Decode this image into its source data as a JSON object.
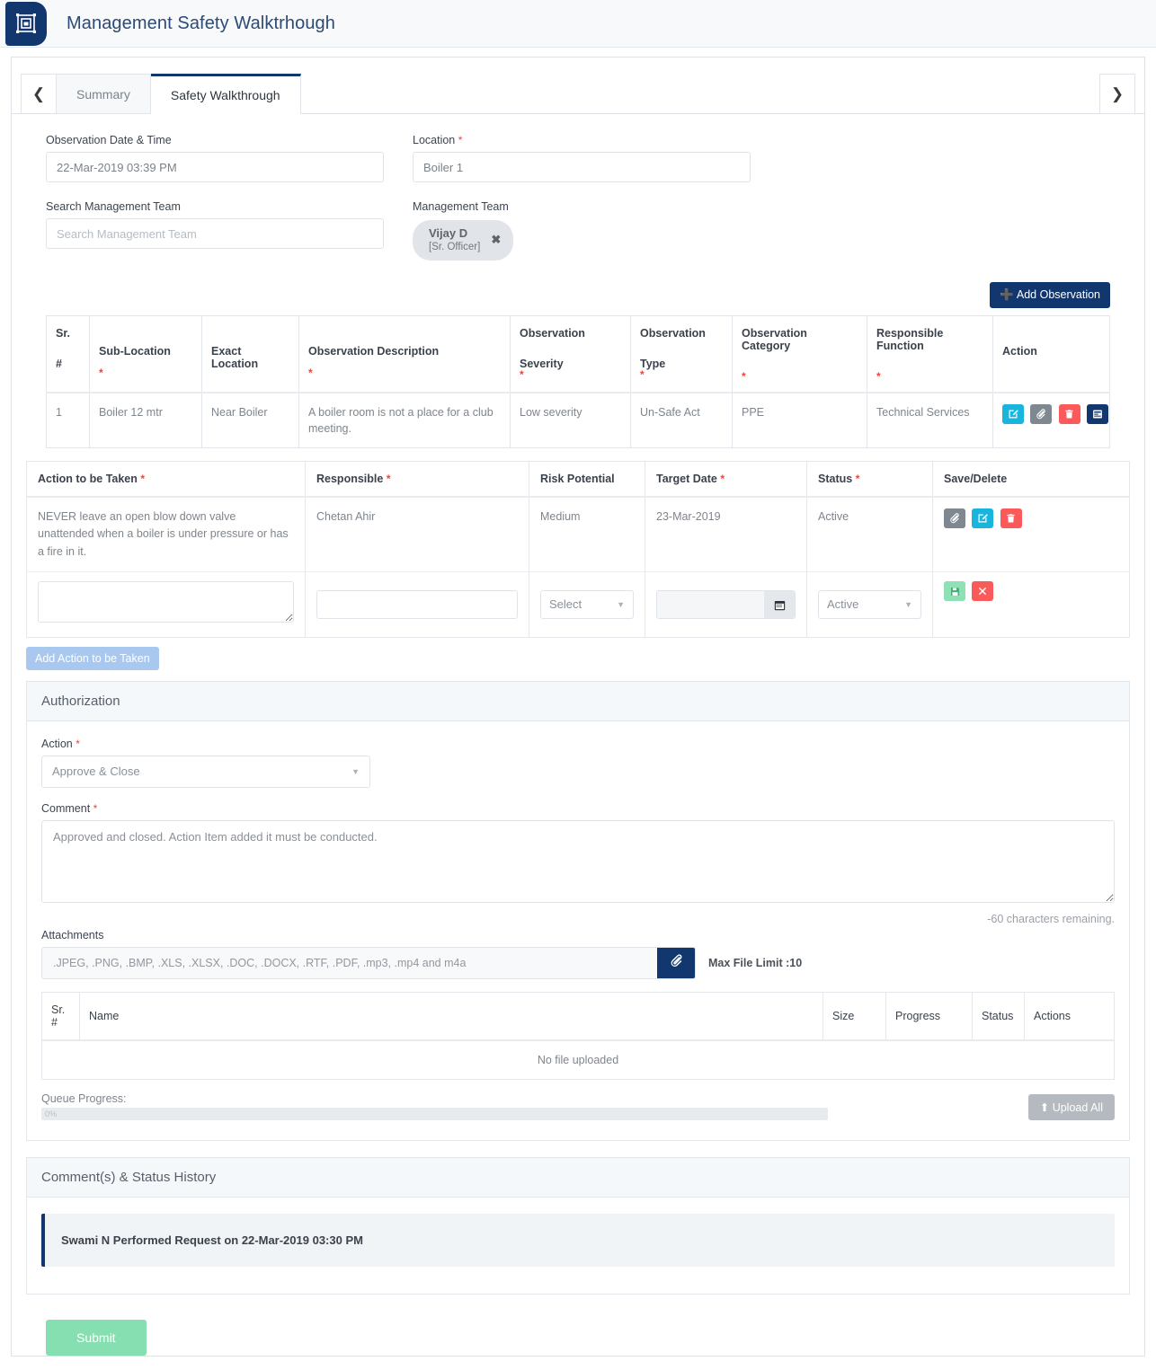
{
  "app": {
    "title": "Management Safety Walktrhough",
    "logo_icon": "app-logo-icon"
  },
  "tabs": {
    "prev_icon": "chevron-left-icon",
    "next_icon": "chevron-right-icon",
    "items": [
      {
        "label": "Summary",
        "active": false
      },
      {
        "label": "Safety Walkthrough",
        "active": true
      }
    ]
  },
  "form": {
    "observation_datetime": {
      "label": "Observation Date & Time",
      "value": "22-Mar-2019 03:39 PM"
    },
    "location": {
      "label": "Location",
      "required": "*",
      "value": "Boiler 1"
    },
    "search_management_team": {
      "label": "Search Management Team",
      "placeholder": "Search Management Team",
      "value": ""
    },
    "management_team": {
      "label": "Management Team",
      "chips": [
        {
          "name": "Vijay D",
          "role": "[Sr. Officer]",
          "remove_icon": "close-icon"
        }
      ]
    }
  },
  "toolbar": {
    "add_observation_label": "Add Observation",
    "add_observation_icon": "plus-icon"
  },
  "observation_table": {
    "headers": [
      {
        "line1": "Sr.",
        "line2": "#",
        "required": ""
      },
      {
        "line1": "",
        "line2": "Sub-Location",
        "required": "*"
      },
      {
        "line1": "",
        "line2": "Exact Location",
        "required": ""
      },
      {
        "line1": "",
        "line2": "Observation Description",
        "required": "*"
      },
      {
        "line1": "Observation",
        "line2": "Severity",
        "required": "*"
      },
      {
        "line1": "Observation",
        "line2": "Type",
        "required": "*"
      },
      {
        "line1": "Observation Category",
        "line2": "",
        "required": "*"
      },
      {
        "line1": "Responsible Function",
        "line2": "",
        "required": "*"
      },
      {
        "line1": "",
        "line2": "Action",
        "required": ""
      }
    ],
    "rows": [
      {
        "sr": "1",
        "sub_location": "Boiler 12 mtr",
        "exact_location": "Near Boiler",
        "description": "A boiler room is not a place for a club meeting.",
        "severity": "Low severity",
        "type": "Un-Safe Act",
        "category": "PPE",
        "responsible_function": "Technical Services",
        "actions": [
          {
            "icon": "edit-icon",
            "color": "#19b5dd"
          },
          {
            "icon": "paperclip-icon",
            "color": "#7f8790"
          },
          {
            "icon": "trash-icon",
            "color": "#fb5a5a"
          },
          {
            "icon": "form-list-icon",
            "color": "#12376e"
          }
        ]
      }
    ]
  },
  "action_table": {
    "headers": [
      {
        "label": "Action to be Taken",
        "required": "*"
      },
      {
        "label": "Responsible",
        "required": "*"
      },
      {
        "label": "Risk Potential",
        "required": ""
      },
      {
        "label": "Target Date",
        "required": "*"
      },
      {
        "label": "Status",
        "required": "*"
      },
      {
        "label": "Save/Delete",
        "required": ""
      }
    ],
    "rows": [
      {
        "action": "NEVER leave an open blow down valve unattended when a boiler is under pressure or has a fire in it.",
        "responsible": "Chetan Ahir",
        "risk_potential": "Medium",
        "target_date": "23-Mar-2019",
        "status": "Active",
        "buttons": [
          {
            "icon": "paperclip-icon",
            "color": "#7f8790"
          },
          {
            "icon": "edit-icon",
            "color": "#19b5dd"
          },
          {
            "icon": "trash-icon",
            "color": "#fb5a5a"
          }
        ]
      }
    ],
    "new_row": {
      "action_value": "",
      "responsible_value": "",
      "risk_potential_value": "Select",
      "target_date_value": "",
      "target_date_icon": "calendar-icon",
      "status_value": "Active",
      "buttons": [
        {
          "icon": "save-icon",
          "color": "#8fe0b4"
        },
        {
          "icon": "cancel-icon",
          "color": "#fb5a5a"
        }
      ]
    },
    "add_action_label": "Add Action to be Taken"
  },
  "authorization": {
    "panel_title": "Authorization",
    "action": {
      "label": "Action",
      "required": "*",
      "value": "Approve & Close",
      "caret_icon": "chevron-down-icon"
    },
    "comment": {
      "label": "Comment",
      "required": "*",
      "value": "Approved and closed. Action Item added it must be conducted.",
      "chars_remaining": "-60 characters remaining."
    },
    "attachments": {
      "label": "Attachments",
      "accepted": ".JPEG, .PNG, .BMP, .XLS, .XLSX, .DOC, .DOCX, .RTF, .PDF, .mp3, .mp4 and m4a",
      "browse_icon": "paperclip-icon",
      "max_file_limit": "Max File Limit :10",
      "table": {
        "headers": [
          "Sr. #",
          "Name",
          "Size",
          "Progress",
          "Status",
          "Actions"
        ],
        "empty_text": "No file uploaded"
      },
      "queue_label": "Queue Progress:",
      "queue_percent": "0%",
      "upload_all_label": "Upload All",
      "upload_all_icon": "upload-icon"
    }
  },
  "history": {
    "panel_title": "Comment(s) & Status History",
    "items": [
      {
        "text": "Swami N Performed Request on 22-Mar-2019 03:30 PM"
      }
    ]
  },
  "footer": {
    "submit_label": "Submit"
  }
}
